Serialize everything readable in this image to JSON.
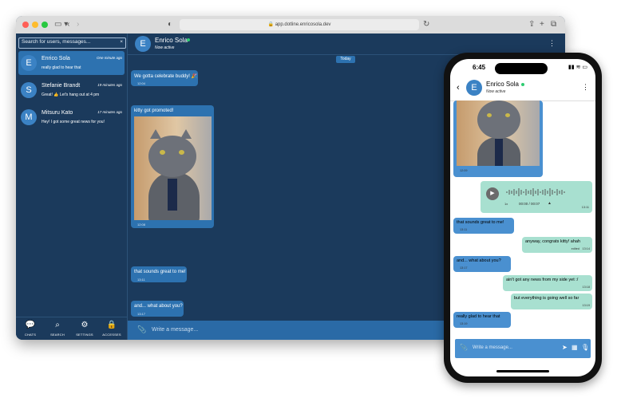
{
  "browser": {
    "url": "app.dotline.enricosola.dev",
    "traffic_light_colors": [
      "#ff5f57",
      "#febc2e",
      "#28c840"
    ]
  },
  "search": {
    "placeholder": "Search for users, messages...",
    "clear_icon": "×"
  },
  "conversations": [
    {
      "initial": "E",
      "name": "Enrico Sola",
      "preview": "really glad to hear that",
      "time": "One minute ago"
    },
    {
      "initial": "S",
      "name": "Stefanie Brandt",
      "preview": "Great! 👍 Let's hang out at 4 pm",
      "time": "19 minutes ago"
    },
    {
      "initial": "M",
      "name": "Mitsuru Kato",
      "preview": "Hey! I got some great news for you!",
      "time": "17 minutes ago"
    }
  ],
  "bottom_nav": [
    {
      "icon": "chats-icon",
      "label": "CHATS"
    },
    {
      "icon": "search-icon",
      "label": "SEARCH"
    },
    {
      "icon": "settings-icon",
      "label": "SETTINGS"
    },
    {
      "icon": "lock-icon",
      "label": "ACCESSES"
    }
  ],
  "chat": {
    "initial": "E",
    "name": "Enrico Sola",
    "status": "Now active",
    "date_separator": "Today",
    "input_placeholder": "Write a message...",
    "messages": [
      {
        "text": "We gotta celebrate buddy! 🎉",
        "time": "12:04"
      },
      {
        "text": "kitty got promoted!",
        "time": "12:08"
      },
      {
        "text": "that sounds great to me!",
        "time": "13:11"
      },
      {
        "text": "and... what about you?",
        "time": "13:17"
      }
    ]
  },
  "phone": {
    "time": "6:45",
    "contact_initial": "E",
    "contact_name": "Enrico Sola",
    "contact_status": "Now active",
    "input_placeholder": "Write a message...",
    "messages": [
      {
        "dir": "in",
        "text": "",
        "time": "12:09"
      },
      {
        "dir": "out",
        "text": "00:00 / 00:07",
        "time": "13:11"
      },
      {
        "dir": "in",
        "text": "that sounds great to me!",
        "time": "13:11"
      },
      {
        "dir": "out",
        "text": "anyway, congrats kitty! ahah",
        "time": "13:14",
        "edited": "edited"
      },
      {
        "dir": "in",
        "text": "and... what about you?",
        "time": "13:17"
      },
      {
        "dir": "out",
        "text": "ain't got any news from my side yet :/",
        "time": "13:18"
      },
      {
        "dir": "out",
        "text": "but everything is going well so far",
        "time": "13:19"
      },
      {
        "dir": "in",
        "text": "really glad to hear that",
        "time": "13:19"
      }
    ]
  },
  "colors": {
    "dark_bg": "#1b3a5c",
    "bubble_in": "#2d72b0",
    "bubble_out": "#a8e0d0",
    "online": "#2ecc71"
  }
}
